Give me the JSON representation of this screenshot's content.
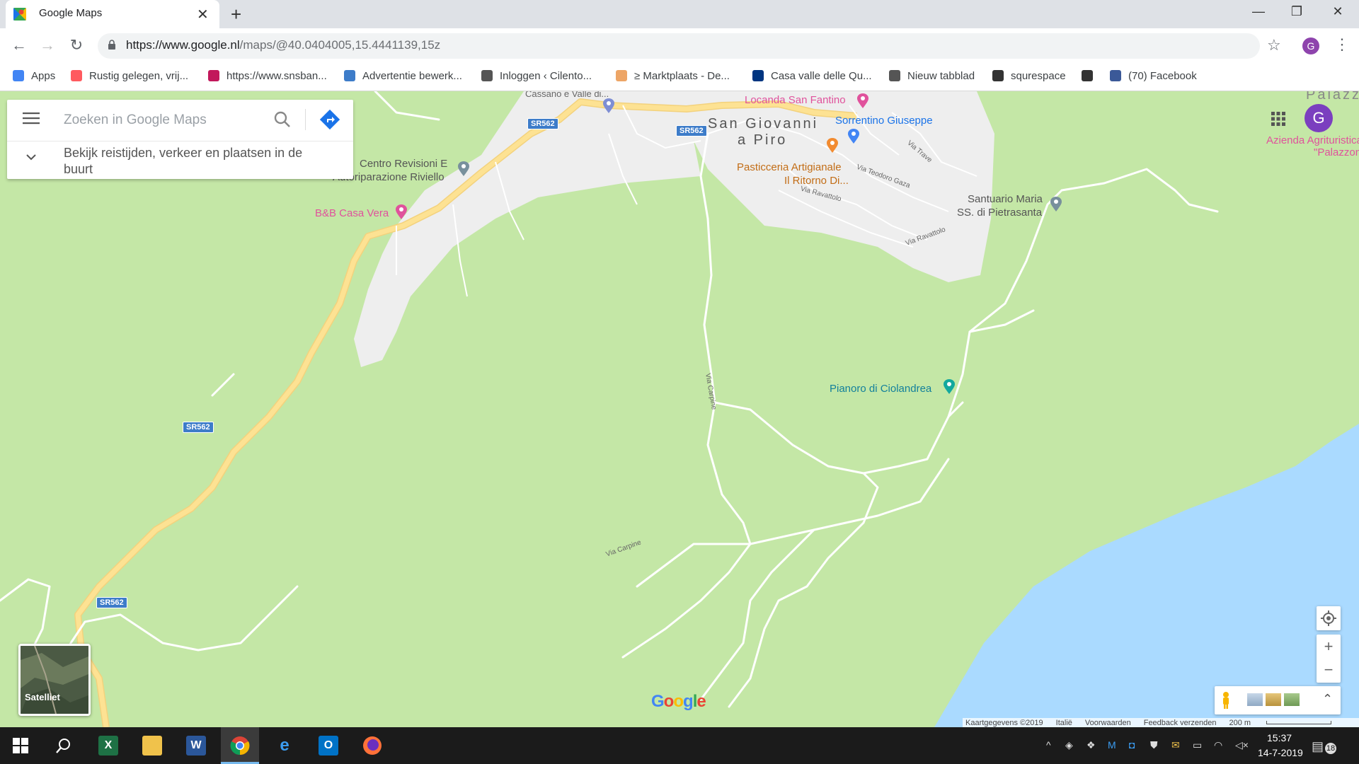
{
  "browser": {
    "tab_title": "Google Maps",
    "url_host": "https://www.google.nl",
    "url_rest": "/maps/@40.0404005,15.4441139,15z",
    "profile_initial": "G"
  },
  "bookmarks": [
    {
      "label": "Apps",
      "icon": "apps-grid-icon",
      "color": "#4285f4"
    },
    {
      "label": "Rustig gelegen, vrij...",
      "icon": "airbnb-icon",
      "color": "#ff5a5f"
    },
    {
      "label": "https://www.snsban...",
      "icon": "sns-icon",
      "color": "#c2185b"
    },
    {
      "label": "Advertentie bewerk...",
      "icon": "home-icon",
      "color": "#3d7cc9"
    },
    {
      "label": "Inloggen ‹ Cilento...",
      "icon": "globe-icon",
      "color": "#555555"
    },
    {
      "label": "≥ Marktplaats - De...",
      "icon": "marktplaats-icon",
      "color": "#eda566"
    },
    {
      "label": "Casa valle delle Qu...",
      "icon": "booking-icon",
      "color": "#003580"
    },
    {
      "label": "Nieuw tabblad",
      "icon": "globe-icon",
      "color": "#555555"
    },
    {
      "label": "squrespace",
      "icon": "cube-icon",
      "color": "#333333"
    },
    {
      "label": "",
      "icon": "cube-icon",
      "color": "#333333"
    },
    {
      "label": "(70) Facebook",
      "icon": "facebook-icon",
      "color": "#3b5998"
    }
  ],
  "search": {
    "placeholder": "Zoeken in Google Maps",
    "hint": "Bekijk reistijden, verkeer en plaatsen in de buurt"
  },
  "map": {
    "town": [
      "San Giovanni",
      "a Piro"
    ],
    "partial_labels": {
      "top": "Cassano e Valle di...",
      "right_town": "Palazzone"
    },
    "pois": [
      {
        "label": "Locanda San Fantino",
        "kind": "hotel"
      },
      {
        "label": "Sorrentino Giuseppe",
        "kind": "shop"
      },
      {
        "label": "Pasticceria Artigianale",
        "label2": "Il Ritorno Di...",
        "kind": "food"
      },
      {
        "label": "Centro Revisioni E",
        "label2": "Autoriparazione Riviello",
        "kind": "place"
      },
      {
        "label": "B&B Casa Vera",
        "kind": "hotel"
      },
      {
        "label": "Santuario Maria",
        "label2": "SS. di Pietrasanta",
        "kind": "place"
      },
      {
        "label": "Pianoro di Ciolandrea",
        "kind": "park"
      },
      {
        "label": "Azienda Agrituristica",
        "label2": "\"Palazzone\"",
        "kind": "hotel"
      }
    ],
    "road_shields": [
      "SR562",
      "SR562",
      "SR562",
      "SR562"
    ],
    "streets": [
      "Via Trave",
      "Via Teodoro Gaza",
      "Via Ravattolo",
      "Via Ravattolo",
      "Via Carpine",
      "Via Carpine"
    ],
    "layer_toggle": "Satelliet",
    "logo": "Google",
    "attribution": [
      "Kaartgegevens ©2019",
      "Italië",
      "Voorwaarden",
      "Feedback verzenden",
      "200 m"
    ],
    "colors": {
      "land": "#c4e7a6",
      "urban": "#eeeeee",
      "water": "#aadaff",
      "highway": "#fde293",
      "road": "#ffffff"
    }
  },
  "taskbar": {
    "apps": [
      "windows-start-icon",
      "search-icon",
      "excel-icon",
      "file-explorer-icon",
      "word-icon",
      "chrome-icon",
      "edge-icon",
      "outlook-icon",
      "firefox-icon"
    ],
    "time": "15:37",
    "date": "14-7-2019",
    "notification_count": "18"
  }
}
